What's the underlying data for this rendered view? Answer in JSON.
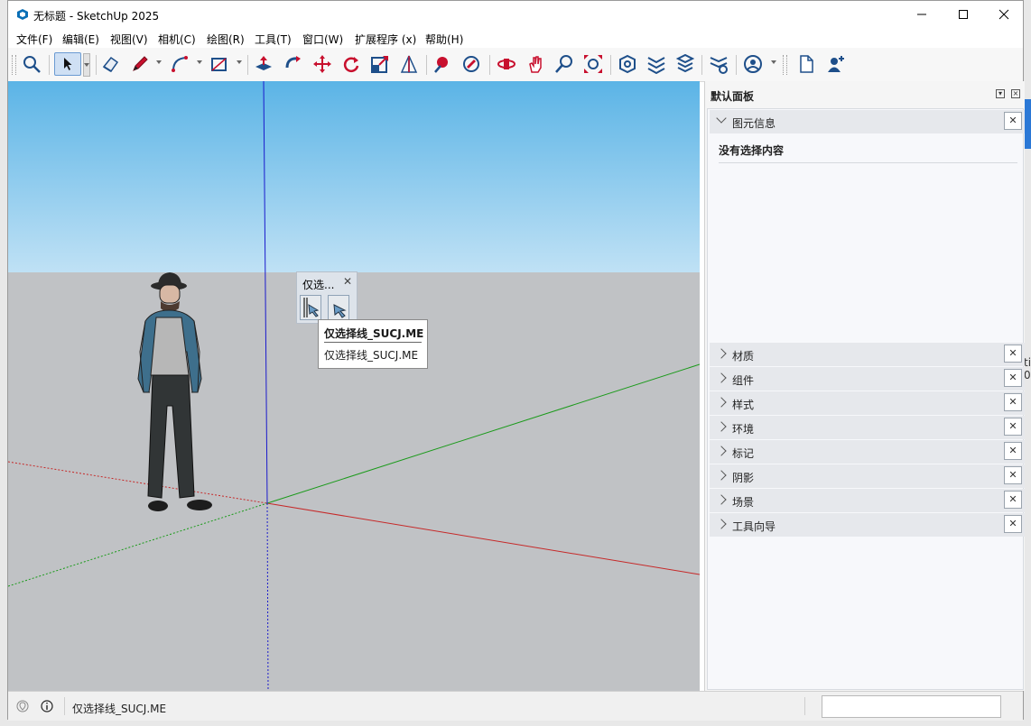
{
  "window": {
    "title": "无标题 - SketchUp 2025",
    "controls": [
      "minimize-icon",
      "maximize-icon",
      "close-icon"
    ]
  },
  "menu": [
    "文件(F)",
    "编辑(E)",
    "视图(V)",
    "相机(C)",
    "绘图(R)",
    "工具(T)",
    "窗口(W)",
    "扩展程序 (x)",
    "帮助(H)"
  ],
  "toolbar": {
    "tools": [
      "search-icon",
      "select-icon",
      "eraser-icon",
      "pencil-icon",
      "arc-icon",
      "rectangle-icon",
      "push-pull-icon",
      "follow-me-icon",
      "move-icon",
      "rotate-icon",
      "scale-icon",
      "tape-measure-icon",
      "paint-bucket-icon",
      "orbit-icon",
      "pan-icon",
      "zoom-icon",
      "zoom-extents-icon",
      "warehouse-icon",
      "extension-warehouse-icon",
      "layout-icon",
      "extension-manager-icon",
      "account-icon",
      "new-file-icon",
      "add-user-icon"
    ]
  },
  "popup": {
    "title": "仅选...",
    "close": "✕"
  },
  "tooltip": {
    "title": "仅选择线_SUCJ.ME",
    "description": "仅选择线_SUCJ.ME"
  },
  "panel": {
    "title": "默认面板",
    "entity_info": {
      "label": "图元信息",
      "content": "没有选择内容"
    },
    "sections": [
      "材质",
      "组件",
      "样式",
      "环境",
      "标记",
      "阴影",
      "场景",
      "工具向导"
    ],
    "close_glyph": "✕"
  },
  "statusbar": {
    "text": "仅选择线_SUCJ.ME"
  },
  "background": {
    "right_text_1": "ti",
    "right_text_2": "0"
  },
  "colors": {
    "sky_top": "#5bb4e6",
    "sky_bottom": "#bfe1f5",
    "ground": "#c0c2c5",
    "axis_red": "#cc0000",
    "axis_green": "#1a9a1a",
    "axis_blue": "#1a1acc"
  }
}
